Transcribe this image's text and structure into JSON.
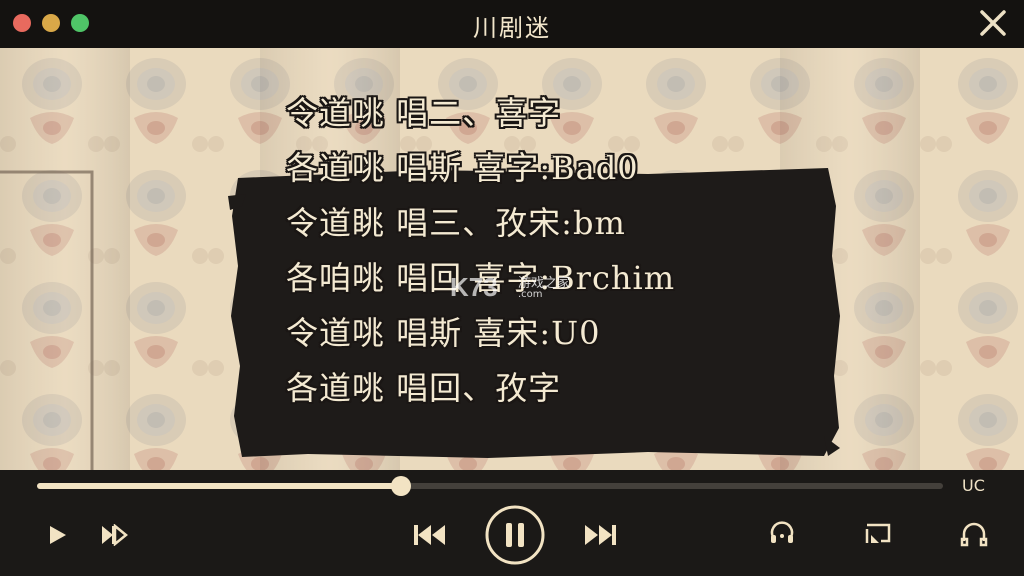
{
  "window": {
    "title": "川剧迷"
  },
  "subtitles": [
    "令道咷 唱二、喜字",
    "各道咷 唱斯  喜字:Bad0",
    "令道眺 唱三、孜宋:bm",
    "各咱咷 唱回  喜字:Brchim",
    "令道咷 唱斯  喜宋:U0",
    "各道咷 唱回、孜字"
  ],
  "watermark": {
    "logo": "K73",
    "text": "游戏之家",
    "sub": ".com"
  },
  "player": {
    "progress": 0.402,
    "time_label": "UC",
    "icons": {
      "play": "play-icon",
      "next_frame": "skip-icon",
      "prev": "previous-icon",
      "pause": "pause-icon",
      "next": "next-icon",
      "loop": "loop-icon",
      "cast": "screen-cast-icon",
      "headphones": "headphones-icon"
    }
  },
  "colors": {
    "accent": "#f2e3c3",
    "bar": "#1b1917",
    "board": "#1e1b19"
  }
}
